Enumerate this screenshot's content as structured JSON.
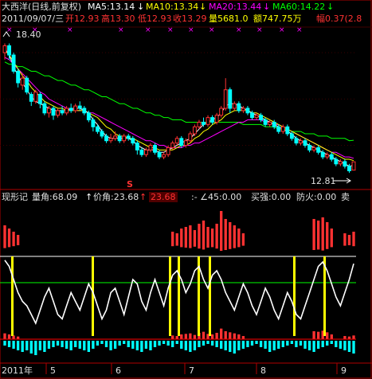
{
  "header": {
    "title": "大西洋(日线,前复权)",
    "ma5_label": "MA5:13.14",
    "ma10_label": "MA10:13.34",
    "ma20_label": "MA20:13.44",
    "ma60_label": "MA60:14.22",
    "ohlc_date": "2011/09/07/三",
    "open": "开12.93",
    "high": "高13.30",
    "low": "低12.93",
    "close": "收13.29",
    "volume": "量5681.0",
    "amount": "额747.75万",
    "change": "幅0.37(2.8"
  },
  "price_panel": {
    "high_marker": "18.40",
    "low_marker": "12.81",
    "signal_mark": "S"
  },
  "indicator_panel": {
    "name": "现形记",
    "vol_angle": "量角:68.09",
    "price_angle": "价角:23.68",
    "angle_value": "23.68",
    "angle45": ":- ∠45:0.00",
    "buy_strength": "买强:0.00",
    "fire_guard": "防火:0.00",
    "sell": "卖"
  },
  "x_axis": {
    "year_label": "2011年",
    "month_labels": [
      "5",
      "6",
      "7",
      "8",
      "9"
    ]
  },
  "colors": {
    "bull": "#ff3232",
    "bear": "#00ffff",
    "ma5": "#ffffff",
    "ma10": "#ffff00",
    "ma20": "#ff00ff",
    "ma60": "#00ff00",
    "grid": "#b00000"
  },
  "chart_data": [
    {
      "type": "candlestick",
      "title": "大西洋(日线,前复权)",
      "ylim": [
        12.3,
        18.9
      ],
      "annotations": [
        {
          "label": "18.40",
          "value": 18.4
        },
        {
          "label": "12.81",
          "value": 12.81
        }
      ],
      "candles": [
        [
          18.0,
          18.3,
          17.7,
          18.4
        ],
        [
          18.3,
          17.9,
          17.7,
          18.4
        ],
        [
          17.9,
          17.2,
          17.1,
          18.0
        ],
        [
          17.2,
          16.7,
          16.5,
          17.3
        ],
        [
          16.6,
          16.9,
          16.4,
          17.1
        ],
        [
          16.9,
          16.3,
          16.2,
          17.0
        ],
        [
          16.2,
          15.9,
          15.7,
          16.3
        ],
        [
          15.9,
          16.3,
          15.8,
          16.4
        ],
        [
          16.2,
          15.8,
          15.6,
          16.3
        ],
        [
          15.8,
          15.4,
          15.3,
          15.9
        ],
        [
          15.4,
          15.6,
          15.2,
          15.7
        ],
        [
          15.6,
          15.3,
          15.1,
          15.7
        ],
        [
          15.3,
          15.5,
          15.2,
          15.6
        ],
        [
          15.5,
          15.4,
          15.3,
          15.7
        ],
        [
          15.4,
          15.6,
          15.3,
          15.7
        ],
        [
          15.6,
          15.5,
          15.4,
          15.8
        ],
        [
          15.5,
          15.7,
          15.4,
          15.8
        ],
        [
          15.7,
          15.6,
          15.5,
          15.9
        ],
        [
          15.6,
          15.4,
          15.3,
          15.7
        ],
        [
          15.4,
          15.1,
          15.0,
          15.5
        ],
        [
          15.1,
          14.8,
          14.6,
          15.2
        ],
        [
          14.8,
          14.6,
          14.5,
          14.9
        ],
        [
          14.6,
          14.4,
          14.3,
          14.7
        ],
        [
          14.4,
          14.2,
          14.1,
          14.5
        ],
        [
          14.2,
          14.3,
          14.1,
          14.5
        ],
        [
          14.3,
          14.4,
          14.2,
          14.6
        ],
        [
          14.4,
          14.2,
          14.1,
          14.5
        ],
        [
          14.2,
          14.4,
          14.1,
          14.5
        ],
        [
          14.4,
          14.3,
          14.2,
          14.5
        ],
        [
          14.3,
          14.1,
          14.0,
          14.4
        ],
        [
          14.1,
          13.8,
          13.6,
          14.2
        ],
        [
          13.8,
          13.6,
          13.5,
          13.9
        ],
        [
          13.6,
          13.8,
          13.5,
          13.9
        ],
        [
          13.8,
          14.0,
          13.7,
          14.1
        ],
        [
          14.0,
          13.7,
          13.6,
          14.1
        ],
        [
          13.7,
          13.5,
          13.4,
          13.8
        ],
        [
          13.5,
          13.6,
          13.4,
          13.7
        ],
        [
          13.6,
          13.9,
          13.5,
          14.0
        ],
        [
          13.9,
          14.1,
          13.8,
          14.2
        ],
        [
          14.1,
          14.3,
          14.0,
          14.4
        ],
        [
          14.3,
          14.0,
          13.9,
          14.4
        ],
        [
          14.0,
          14.2,
          13.9,
          14.3
        ],
        [
          14.2,
          14.5,
          14.1,
          14.6
        ],
        [
          14.5,
          14.8,
          14.4,
          14.9
        ],
        [
          14.8,
          15.0,
          14.7,
          15.1
        ],
        [
          15.0,
          14.9,
          14.8,
          15.2
        ],
        [
          14.9,
          15.2,
          14.8,
          15.3
        ],
        [
          15.2,
          15.0,
          14.9,
          15.3
        ],
        [
          15.0,
          15.3,
          14.9,
          15.4
        ],
        [
          15.3,
          15.6,
          15.2,
          15.7
        ],
        [
          15.6,
          16.4,
          15.5,
          16.9
        ],
        [
          16.4,
          15.6,
          15.4,
          16.5
        ],
        [
          15.6,
          15.8,
          15.5,
          15.9
        ],
        [
          15.8,
          15.5,
          15.4,
          15.9
        ],
        [
          15.5,
          15.6,
          15.4,
          15.7
        ],
        [
          15.6,
          15.4,
          15.3,
          15.7
        ],
        [
          15.4,
          15.2,
          15.1,
          15.5
        ],
        [
          15.2,
          15.3,
          15.1,
          15.4
        ],
        [
          15.3,
          15.1,
          15.0,
          15.4
        ],
        [
          15.1,
          14.9,
          14.8,
          15.2
        ],
        [
          14.9,
          15.0,
          14.8,
          15.1
        ],
        [
          15.0,
          14.8,
          14.7,
          15.1
        ],
        [
          14.8,
          14.6,
          14.5,
          14.9
        ],
        [
          14.6,
          14.8,
          14.5,
          14.9
        ],
        [
          14.8,
          14.5,
          14.4,
          14.9
        ],
        [
          14.5,
          14.3,
          14.2,
          14.6
        ],
        [
          14.3,
          14.1,
          14.0,
          14.4
        ],
        [
          14.1,
          14.2,
          14.0,
          14.3
        ],
        [
          14.2,
          14.0,
          13.9,
          14.3
        ],
        [
          14.0,
          13.8,
          13.7,
          14.1
        ],
        [
          13.8,
          13.9,
          13.7,
          14.0
        ],
        [
          13.9,
          13.7,
          13.6,
          14.0
        ],
        [
          13.7,
          13.5,
          13.4,
          13.8
        ],
        [
          13.5,
          13.6,
          13.4,
          13.7
        ],
        [
          13.6,
          13.4,
          13.3,
          13.7
        ],
        [
          13.4,
          13.2,
          13.1,
          13.5
        ],
        [
          13.2,
          13.3,
          13.1,
          13.4
        ],
        [
          13.3,
          13.1,
          13.0,
          13.4
        ],
        [
          13.1,
          12.9,
          12.81,
          13.2
        ],
        [
          12.93,
          13.29,
          12.93,
          13.3
        ]
      ],
      "series": [
        {
          "name": "MA5",
          "values": [
            18.2,
            17.9,
            17.4,
            17.0,
            16.7,
            16.4,
            16.1,
            15.9,
            15.8,
            15.7,
            15.6,
            15.5,
            15.5,
            15.5,
            15.5,
            15.6,
            15.6,
            15.6,
            15.5,
            15.4,
            15.1,
            14.9,
            14.6,
            14.4,
            14.3,
            14.3,
            14.3,
            14.3,
            14.3,
            14.2,
            14.0,
            13.9,
            13.8,
            13.8,
            13.8,
            13.7,
            13.7,
            13.8,
            13.9,
            14.0,
            14.1,
            14.2,
            14.3,
            14.5,
            14.7,
            14.9,
            15.0,
            15.1,
            15.2,
            15.4,
            15.7,
            15.8,
            15.8,
            15.7,
            15.6,
            15.5,
            15.4,
            15.3,
            15.2,
            15.1,
            15.0,
            14.9,
            14.8,
            14.7,
            14.6,
            14.5,
            14.3,
            14.2,
            14.1,
            14.0,
            13.9,
            13.8,
            13.7,
            13.6,
            13.5,
            13.4,
            13.3,
            13.2,
            13.1,
            13.14
          ]
        },
        {
          "name": "MA10",
          "values": [
            18.1,
            17.9,
            17.6,
            17.3,
            17.0,
            16.8,
            16.5,
            16.3,
            16.1,
            15.9,
            15.8,
            15.7,
            15.6,
            15.6,
            15.5,
            15.5,
            15.5,
            15.5,
            15.5,
            15.4,
            15.3,
            15.2,
            15.0,
            14.8,
            14.7,
            14.5,
            14.4,
            14.4,
            14.3,
            14.3,
            14.2,
            14.1,
            14.0,
            13.9,
            13.9,
            13.8,
            13.8,
            13.8,
            13.8,
            13.9,
            14.0,
            14.0,
            14.1,
            14.3,
            14.4,
            14.6,
            14.7,
            14.9,
            15.0,
            15.1,
            15.3,
            15.4,
            15.5,
            15.5,
            15.5,
            15.5,
            15.4,
            15.4,
            15.3,
            15.2,
            15.1,
            15.0,
            14.9,
            14.8,
            14.7,
            14.6,
            14.5,
            14.4,
            14.3,
            14.2,
            14.1,
            14.0,
            13.9,
            13.8,
            13.7,
            13.6,
            13.5,
            13.4,
            13.4,
            13.34
          ]
        },
        {
          "name": "MA20",
          "values": [
            17.8,
            17.7,
            17.5,
            17.3,
            17.1,
            16.9,
            16.7,
            16.5,
            16.3,
            16.2,
            16.0,
            15.9,
            15.8,
            15.7,
            15.6,
            15.6,
            15.5,
            15.5,
            15.5,
            15.4,
            15.4,
            15.3,
            15.2,
            15.1,
            15.0,
            14.9,
            14.8,
            14.7,
            14.6,
            14.5,
            14.4,
            14.3,
            14.2,
            14.2,
            14.1,
            14.0,
            14.0,
            13.9,
            13.9,
            13.9,
            13.9,
            14.0,
            14.0,
            14.1,
            14.1,
            14.2,
            14.3,
            14.4,
            14.5,
            14.6,
            14.7,
            14.8,
            14.9,
            15.0,
            15.0,
            15.1,
            15.1,
            15.1,
            15.1,
            15.0,
            15.0,
            14.9,
            14.9,
            14.8,
            14.7,
            14.6,
            14.5,
            14.4,
            14.3,
            14.2,
            14.1,
            14.0,
            13.9,
            13.8,
            13.7,
            13.7,
            13.6,
            13.5,
            13.5,
            13.44
          ]
        },
        {
          "name": "MA60",
          "values": [
            17.6,
            17.5,
            17.5,
            17.4,
            17.4,
            17.3,
            17.2,
            17.2,
            17.1,
            17.0,
            17.0,
            16.9,
            16.8,
            16.8,
            16.7,
            16.6,
            16.6,
            16.5,
            16.4,
            16.4,
            16.3,
            16.2,
            16.1,
            16.1,
            16.0,
            15.9,
            15.8,
            15.8,
            15.7,
            15.6,
            15.6,
            15.5,
            15.4,
            15.4,
            15.3,
            15.3,
            15.2,
            15.2,
            15.1,
            15.1,
            15.1,
            15.0,
            15.0,
            15.0,
            15.0,
            15.0,
            15.0,
            15.0,
            15.0,
            15.0,
            15.0,
            15.0,
            15.0,
            15.0,
            14.9,
            14.9,
            14.9,
            14.9,
            14.9,
            14.8,
            14.8,
            14.8,
            14.7,
            14.7,
            14.7,
            14.6,
            14.6,
            14.6,
            14.5,
            14.5,
            14.5,
            14.4,
            14.4,
            14.4,
            14.3,
            14.3,
            14.3,
            14.3,
            14.2,
            14.22
          ]
        }
      ]
    },
    {
      "type": "bar",
      "title": "现形记",
      "series": [
        {
          "name": "上柱",
          "values": [
            22,
            18,
            14,
            10,
            0,
            0,
            0,
            0,
            0,
            0,
            0,
            0,
            0,
            0,
            0,
            0,
            0,
            0,
            0,
            0,
            0,
            0,
            0,
            0,
            0,
            0,
            0,
            0,
            0,
            0,
            0,
            0,
            0,
            0,
            0,
            0,
            0,
            0,
            14,
            12,
            18,
            20,
            22,
            16,
            24,
            28,
            20,
            18,
            24,
            40,
            30,
            26,
            22,
            18,
            12,
            0,
            0,
            0,
            0,
            0,
            0,
            0,
            0,
            0,
            0,
            0,
            0,
            0,
            0,
            0,
            30,
            28,
            32,
            26,
            18,
            0,
            0,
            12,
            10,
            14
          ]
        },
        {
          "name": "下柱",
          "values": [
            -6,
            -8,
            -10,
            -12,
            -14,
            -12,
            -16,
            -18,
            -12,
            -14,
            -10,
            -8,
            -6,
            -8,
            -10,
            -12,
            -8,
            -10,
            -12,
            -14,
            -10,
            -6,
            -4,
            -8,
            -12,
            -10,
            -6,
            -4,
            -8,
            -10,
            -12,
            -14,
            -10,
            -12,
            -8,
            -6,
            -4,
            -6,
            -8,
            -4,
            -10,
            -12,
            -14,
            -12,
            -8,
            -6,
            -4,
            -6,
            -8,
            -10,
            -12,
            -14,
            -16,
            -12,
            -10,
            -8,
            -6,
            -4,
            -8,
            -10,
            -14,
            -12,
            -10,
            -8,
            -6,
            -4,
            -8,
            -6,
            -10,
            -12,
            -14,
            -10,
            -8,
            -6,
            -4,
            -8,
            -10,
            -12,
            -14,
            -16
          ]
        },
        {
          "name": "白线",
          "values": [
            92,
            85,
            70,
            55,
            45,
            40,
            30,
            20,
            35,
            50,
            60,
            45,
            30,
            25,
            40,
            55,
            45,
            35,
            50,
            65,
            55,
            40,
            25,
            35,
            55,
            60,
            45,
            30,
            50,
            70,
            65,
            45,
            35,
            55,
            70,
            55,
            40,
            60,
            75,
            80,
            70,
            55,
            65,
            80,
            85,
            70,
            60,
            75,
            80,
            70,
            55,
            45,
            35,
            50,
            65,
            55,
            40,
            30,
            45,
            60,
            50,
            35,
            25,
            40,
            55,
            45,
            30,
            25,
            40,
            55,
            70,
            85,
            90,
            80,
            65,
            50,
            40,
            55,
            70,
            88
          ]
        }
      ]
    }
  ]
}
